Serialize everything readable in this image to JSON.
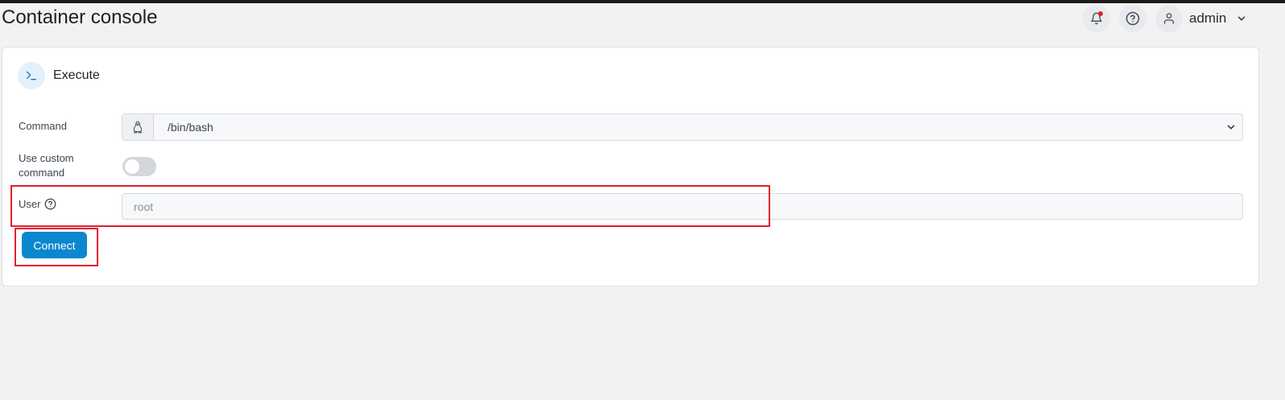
{
  "header": {
    "title": "Container console",
    "notifications_icon": "bell-icon",
    "help_icon": "help-circle-icon",
    "user": {
      "icon": "user-icon",
      "name": "admin",
      "menu_icon": "chevron-down-icon"
    }
  },
  "card": {
    "icon": "terminal-icon",
    "title": "Execute",
    "command": {
      "label": "Command",
      "addon_icon": "linux-icon",
      "value": "/bin/bash"
    },
    "custom_command": {
      "label_line1": "Use custom",
      "label_line2": "command",
      "enabled": false
    },
    "user": {
      "label": "User",
      "help_icon": "help-circle-icon",
      "placeholder": "root"
    },
    "connect_label": "Connect"
  },
  "colors": {
    "accent": "#0b87cf",
    "highlight": "#e0202c",
    "notification_dot": "#e01e2e"
  }
}
